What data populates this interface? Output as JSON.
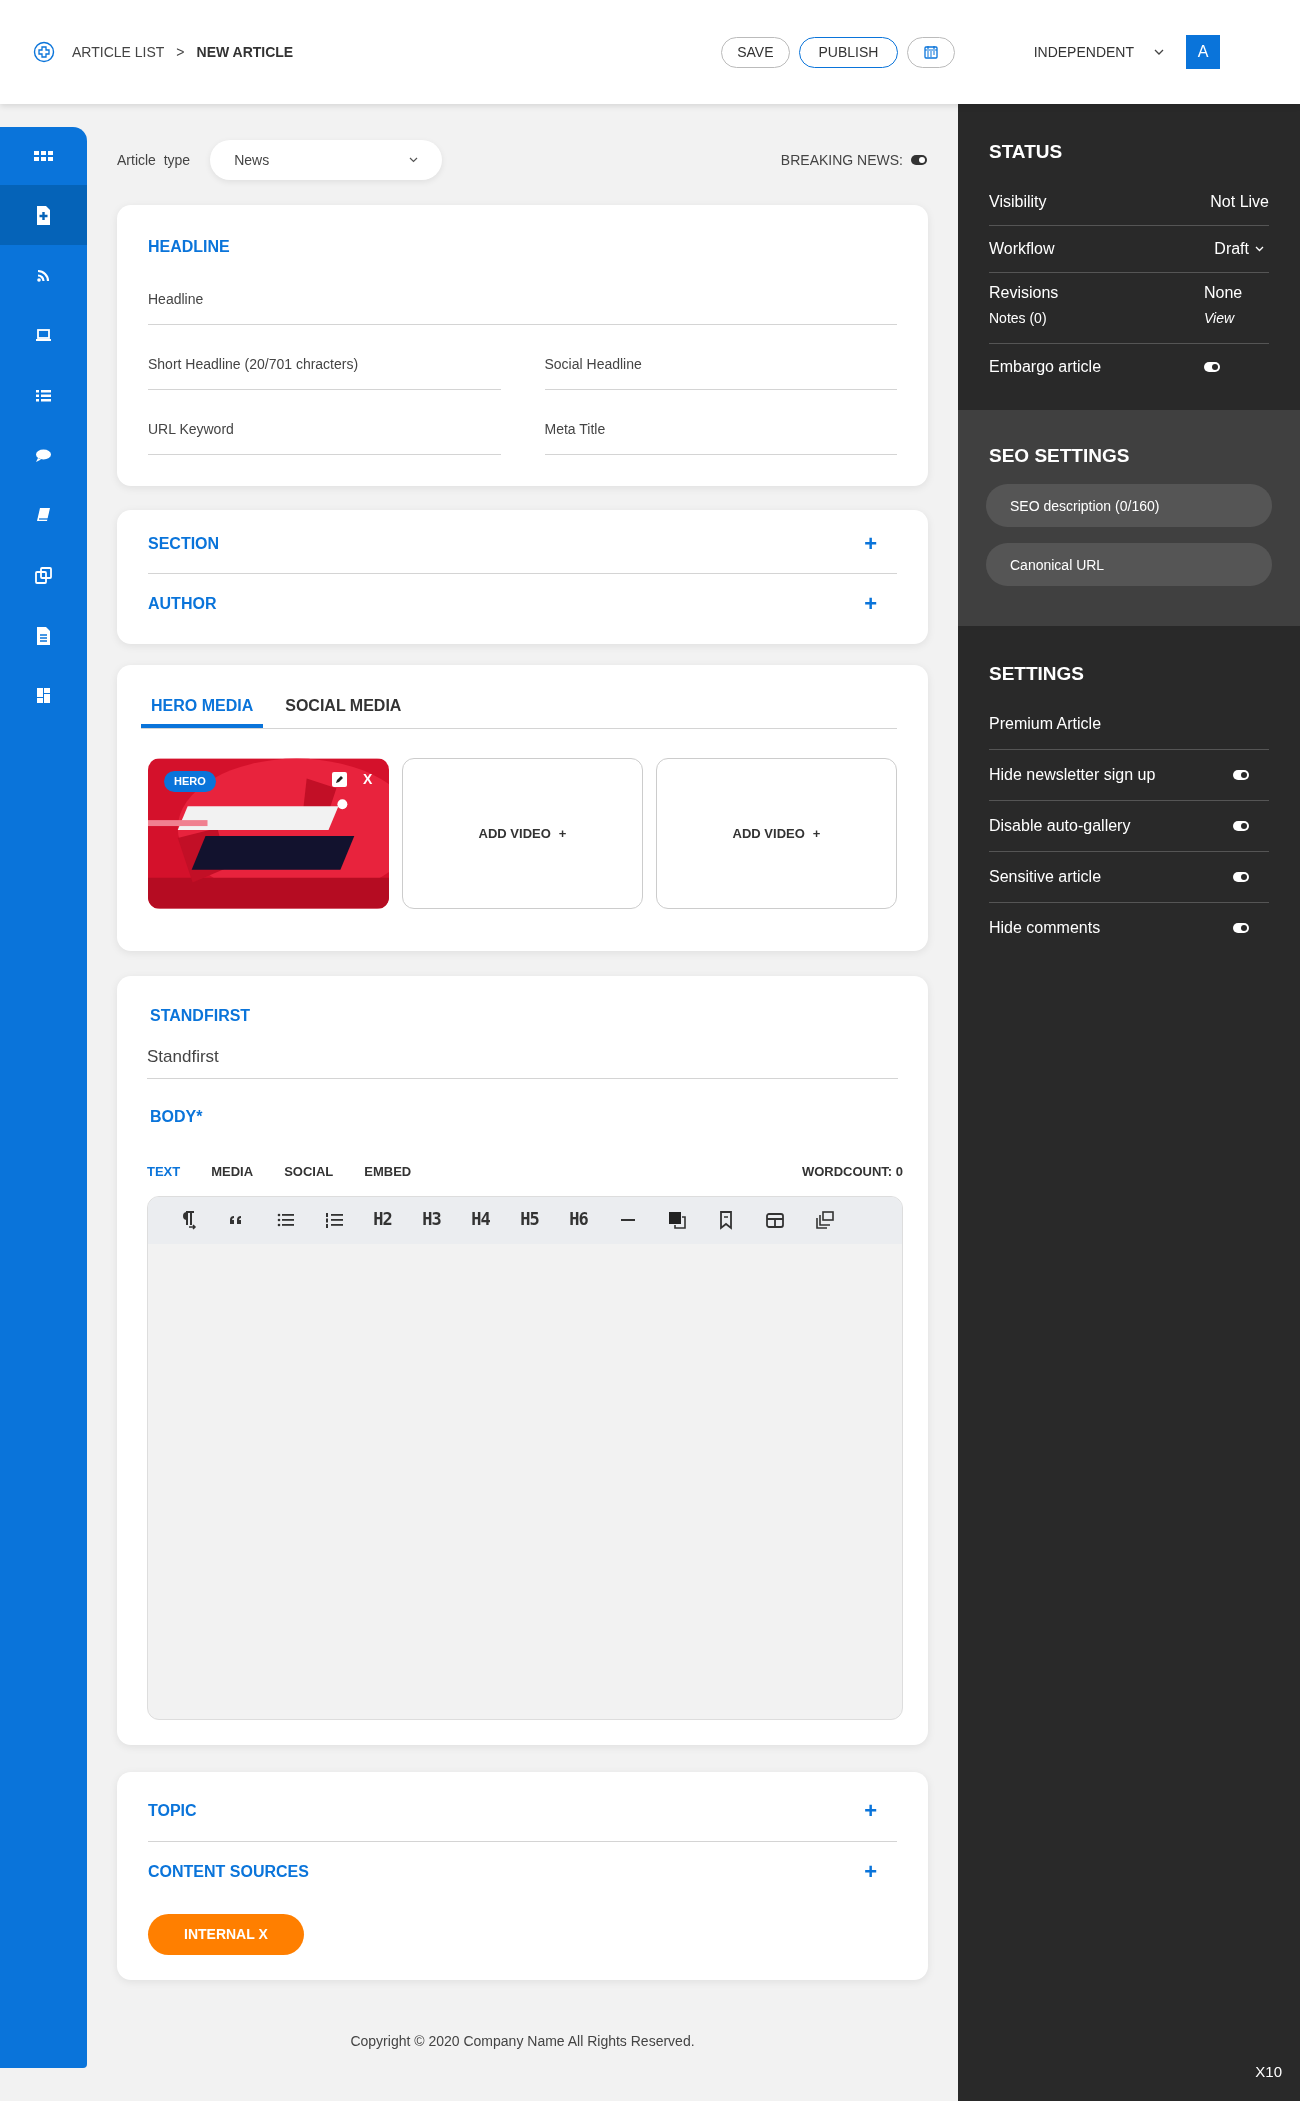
{
  "header": {
    "breadcrumb": [
      {
        "label": "ARTICLE LIST",
        "current": false
      },
      {
        "label": ">",
        "current": false
      },
      {
        "label": "NEW ARTICLE",
        "current": true
      }
    ],
    "buttons": [
      {
        "label": "SAVE",
        "kind": "plain"
      },
      {
        "label": "PUBLISH",
        "kind": "primary"
      },
      {
        "kind": "calendar"
      }
    ],
    "publication": "INDEPENDENT",
    "avatar": "A"
  },
  "sidebar": {
    "items": [
      {
        "kind": "grid",
        "selected": false
      },
      {
        "kind": "new-doc",
        "selected": true
      },
      {
        "kind": "feed",
        "selected": false
      },
      {
        "kind": "laptop",
        "selected": false
      },
      {
        "kind": "list",
        "selected": false
      },
      {
        "kind": "chat",
        "selected": false
      },
      {
        "kind": "book",
        "selected": false
      },
      {
        "kind": "copy",
        "selected": false
      },
      {
        "kind": "doc",
        "selected": false
      },
      {
        "kind": "dashboard",
        "selected": false
      }
    ]
  },
  "article_type": {
    "label": "Article  type",
    "value": "News"
  },
  "breaking_news": {
    "label": "BREAKING NEWS:",
    "on": true
  },
  "headline_card": {
    "title": "HEADLINE",
    "fields": [
      {
        "placeholder": "Headline",
        "wide": true
      },
      {
        "placeholder": "Short Headline (20/701 chracters)",
        "wide": false
      },
      {
        "placeholder": "Social Headline",
        "wide": false
      },
      {
        "placeholder": "URL Keyword",
        "wide": false
      },
      {
        "placeholder": "Meta Title",
        "wide": false
      }
    ]
  },
  "sections": [
    {
      "title": "SECTION",
      "action": "+"
    },
    {
      "title": "AUTHOR",
      "action": "+"
    }
  ],
  "media": {
    "tabs": [
      {
        "label": "HERO MEDIA",
        "selected": true
      },
      {
        "label": "SOCIAL MEDIA",
        "selected": false
      }
    ],
    "items": [
      {
        "kind": "picture",
        "badge": "HERO",
        "close": "X"
      },
      {
        "kind": "add",
        "label": "ADD VIDEO",
        "plus": "+"
      },
      {
        "kind": "add",
        "label": "ADD VIDEO",
        "plus": "+"
      }
    ]
  },
  "standfirst": {
    "title": "STANDFIRST",
    "placeholder": "Standfirst"
  },
  "body": {
    "title": "BODY*",
    "tabs": [
      {
        "label": "TEXT",
        "selected": true
      },
      {
        "label": "MEDIA",
        "selected": false
      },
      {
        "label": "SOCIAL",
        "selected": false
      },
      {
        "label": "EMBED",
        "selected": false
      }
    ],
    "wordcount": "WORDCOUNT: 0",
    "toolbar": [
      {
        "kind": "paragraph"
      },
      {
        "kind": "quote"
      },
      {
        "kind": "bullets"
      },
      {
        "kind": "numbers"
      },
      {
        "kind": "heading",
        "label": "H2"
      },
      {
        "kind": "heading",
        "label": "H3"
      },
      {
        "kind": "heading",
        "label": "H4"
      },
      {
        "kind": "heading",
        "label": "H5"
      },
      {
        "kind": "heading",
        "label": "H6"
      },
      {
        "kind": "rule"
      },
      {
        "kind": "block"
      },
      {
        "kind": "bookmark"
      },
      {
        "kind": "table"
      },
      {
        "kind": "gallery"
      }
    ]
  },
  "bottom_sections": [
    {
      "title": "TOPIC",
      "action": "+"
    },
    {
      "title": "CONTENT SOURCES",
      "action": "+"
    }
  ],
  "tags": [
    {
      "label": "INTERNAL X"
    }
  ],
  "footer": "Copyright © 2020 Company Name  All Rights Reserved.",
  "status": {
    "title": "STATUS",
    "rows": [
      {
        "kind": "value",
        "label": "Visibility",
        "value": "Not Live"
      },
      {
        "kind": "dropdown",
        "label": "Workflow",
        "value": "Draft"
      },
      {
        "kind": "pair",
        "label": "Revisions",
        "value": "None",
        "sub_label": "Notes (0)",
        "sub_value": "View"
      },
      {
        "kind": "toggle",
        "label": "Embargo article",
        "on": true
      }
    ]
  },
  "seo": {
    "title": "SEO SETTINGS",
    "fields": [
      {
        "placeholder": "SEO description (0/160)"
      },
      {
        "placeholder": "Canonical URL"
      }
    ]
  },
  "settings": {
    "title": "SETTINGS",
    "rows": [
      {
        "kind": "plain",
        "label": "Premium Article"
      },
      {
        "kind": "toggle",
        "label": "Hide newsletter sign up",
        "on": true
      },
      {
        "kind": "toggle",
        "label": "Disable auto-gallery",
        "on": true
      },
      {
        "kind": "toggle",
        "label": "Sensitive article",
        "on": true
      },
      {
        "kind": "toggle",
        "label": "Hide comments",
        "on": true
      }
    ]
  },
  "corner": "X10"
}
